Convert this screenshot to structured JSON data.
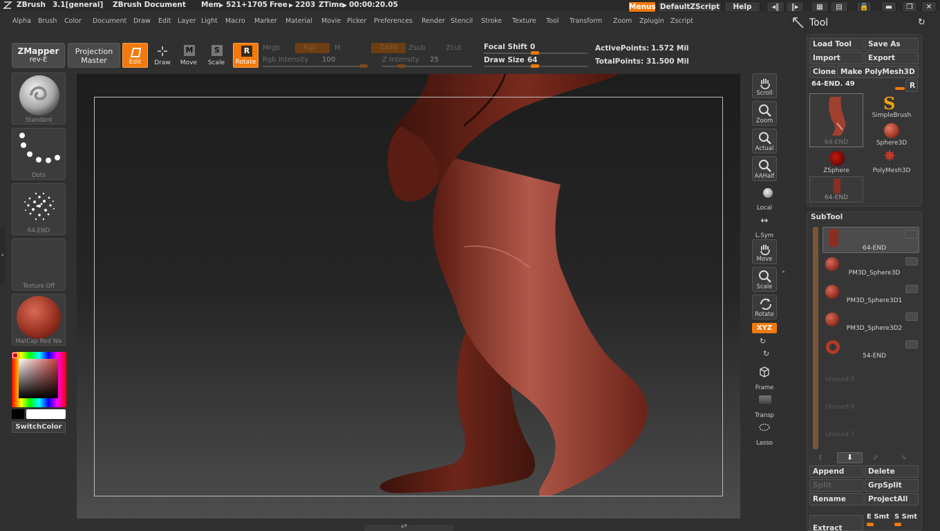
{
  "titlebar": {
    "app": "ZBrush",
    "version": "3.1[general]",
    "document": "ZBrush Document",
    "mem_label": "Mem",
    "mem_value": "521+1705",
    "free_label": "Free",
    "free_value": "2203",
    "ztime_label": "ZTime",
    "ztime_value": "00:00:20.05",
    "menus_btn": "Menus",
    "script_btn": "DefaultZScript",
    "help_btn": "Help"
  },
  "menubar": [
    "Alpha",
    "Brush",
    "Color",
    "Document",
    "Draw",
    "Edit",
    "Layer",
    "Light",
    "Macro",
    "Marker",
    "Material",
    "Movie",
    "Picker",
    "Preferences",
    "Render",
    "Stencil",
    "Stroke",
    "Texture",
    "Tool",
    "Transform",
    "Zoom",
    "Zplugin",
    "Zscript"
  ],
  "shelf": {
    "zmapper_line1": "ZMapper",
    "zmapper_line2": "rev-E",
    "projection_line1": "Projection",
    "projection_line2": "Master",
    "edit": "Edit",
    "draw": "Draw",
    "move": "Move",
    "scale": "Scale",
    "rotate": "Rotate",
    "mrgb": "Mrgb",
    "rgb": "Rgb",
    "m": "M",
    "zadd": "Zadd",
    "zsub": "Zsub",
    "zcut": "Zcut",
    "rgb_intensity_label": "Rgb Intensity",
    "rgb_intensity_value": "100",
    "z_intensity_label": "Z Intensity",
    "z_intensity_value": "25",
    "focal_shift_label": "Focal Shift",
    "focal_shift_value": "0",
    "draw_size_label": "Draw Size",
    "draw_size_value": "64",
    "active_points_label": "ActivePoints:",
    "active_points_value": "1.572 Mil",
    "total_points_label": "TotalPoints:",
    "total_points_value": "31.500 Mil"
  },
  "left_panel": {
    "brush": "Standard",
    "stroke": "Dots",
    "alpha": "64-END",
    "texture": "Texture Off",
    "material": "MatCap Red Wa",
    "switch_color": "SwitchColor"
  },
  "right_tools": [
    "Scroll",
    "Zoom",
    "Actual",
    "AAHalf",
    "Local",
    "L.Sym",
    "Move",
    "Scale",
    "Rotate",
    "XYZ",
    "Frame",
    "Transp",
    "Lasso"
  ],
  "tool_palette": {
    "title": "Tool",
    "load_tool": "Load Tool",
    "save_as": "Save As",
    "import": "Import",
    "export": "Export",
    "clone": "Clone",
    "make_polymesh": "Make PolyMesh3D",
    "current_tool": "64-END. 49",
    "r_btn": "R",
    "thumbs": [
      "64-END",
      "SimpleBrush",
      "Sphere3D",
      "ZSphere",
      "PolyMesh3D",
      "64-END"
    ],
    "subtool_title": "SubTool",
    "subtools": [
      "64-END",
      "PM3D_Sphere3D",
      "PM3D_Sphere3D1",
      "PM3D_Sphere3D2",
      "54-END",
      "Unused 5",
      "Unused 6",
      "Unused 7"
    ],
    "append": "Append",
    "delete": "Delete",
    "split": "Split",
    "grpsplit": "GrpSplit",
    "rename": "Rename",
    "projectall": "ProjectAll",
    "extract": "Extract",
    "e_smt": "E Smt",
    "s_smt": "S Smt"
  },
  "colors": {
    "accent": "#f27a0c",
    "model": "#8a3326"
  }
}
